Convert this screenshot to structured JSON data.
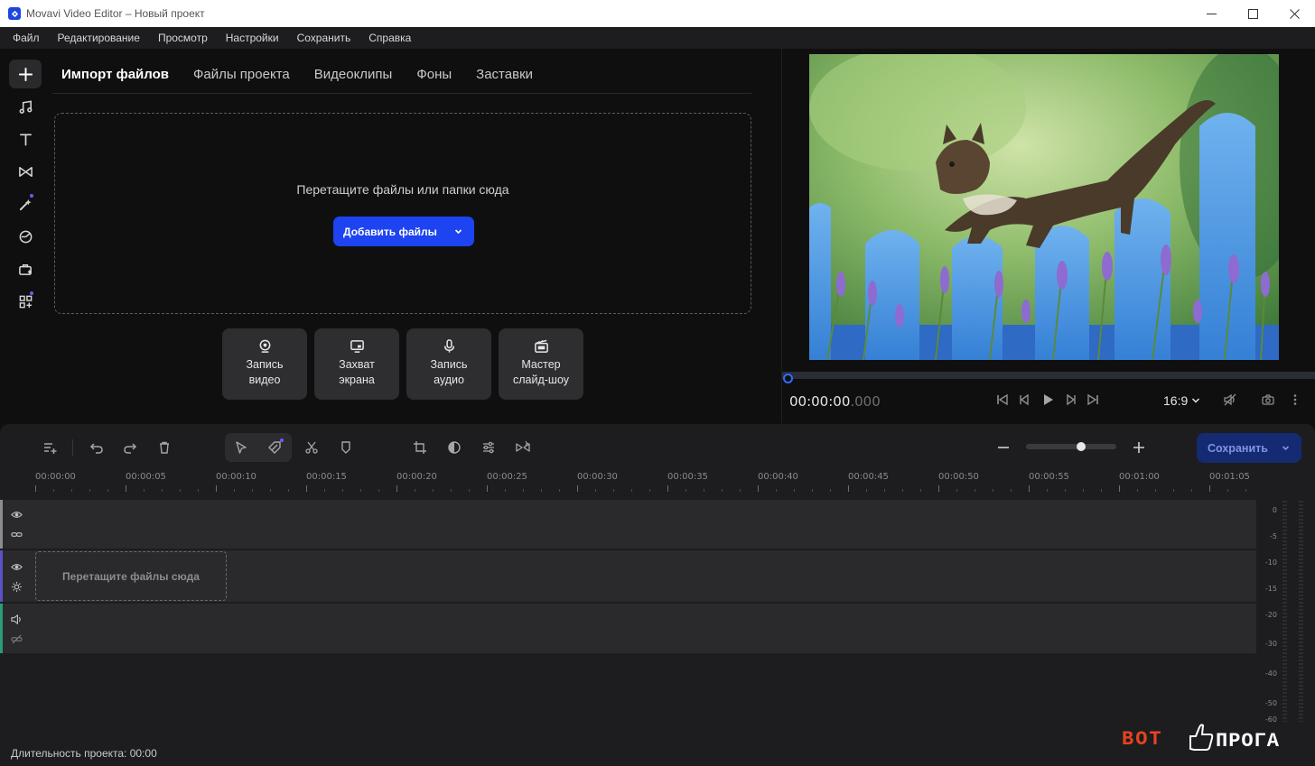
{
  "window": {
    "title": "Movavi Video Editor – Новый проект"
  },
  "menu": [
    "Файл",
    "Редактирование",
    "Просмотр",
    "Настройки",
    "Сохранить",
    "Справка"
  ],
  "tabs": [
    "Импорт файлов",
    "Файлы проекта",
    "Видеоклипы",
    "Фоны",
    "Заставки"
  ],
  "import": {
    "drop_text": "Перетащите файлы или папки сюда",
    "add_files_label": "Добавить файлы"
  },
  "capture_buttons": [
    {
      "line1": "Запись",
      "line2": "видео",
      "icon": "webcam-icon"
    },
    {
      "line1": "Захват",
      "line2": "экрана",
      "icon": "monitor-icon"
    },
    {
      "line1": "Запись",
      "line2": "аудио",
      "icon": "microphone-icon"
    },
    {
      "line1": "Мастер",
      "line2": "слайд-шоу",
      "icon": "clapperboard-icon"
    }
  ],
  "player": {
    "timecode_main": "00:00:00",
    "timecode_ms": ".000",
    "aspect_ratio": "16:9",
    "preview_subject": "kitten walking on blue picket fence among lavender"
  },
  "timeline": {
    "save_label": "Сохранить",
    "ticks": [
      "00:00:00",
      "00:00:05",
      "00:00:10",
      "00:00:15",
      "00:00:20",
      "00:00:25",
      "00:00:30",
      "00:00:35",
      "00:00:40",
      "00:00:45",
      "00:00:50",
      "00:00:55",
      "00:01:00",
      "00:01:05"
    ],
    "drop_clip_text": "Перетащите файлы сюда",
    "vu_scale": [
      "0",
      "-5",
      "-10",
      "-15",
      "-20",
      "-30",
      "-40",
      "-50",
      "-60"
    ],
    "duration": "Длительность проекта: 00:00"
  },
  "colors": {
    "accent": "#1d44f0",
    "save_button": "#142a73",
    "track_titles": "#8c8c90",
    "track_video": "#5a50c8",
    "track_audio": "#2a9d7a",
    "watermark_red": "#e8431e"
  },
  "watermark": {
    "left": "ВОТ",
    "right": "ПРОГА"
  }
}
